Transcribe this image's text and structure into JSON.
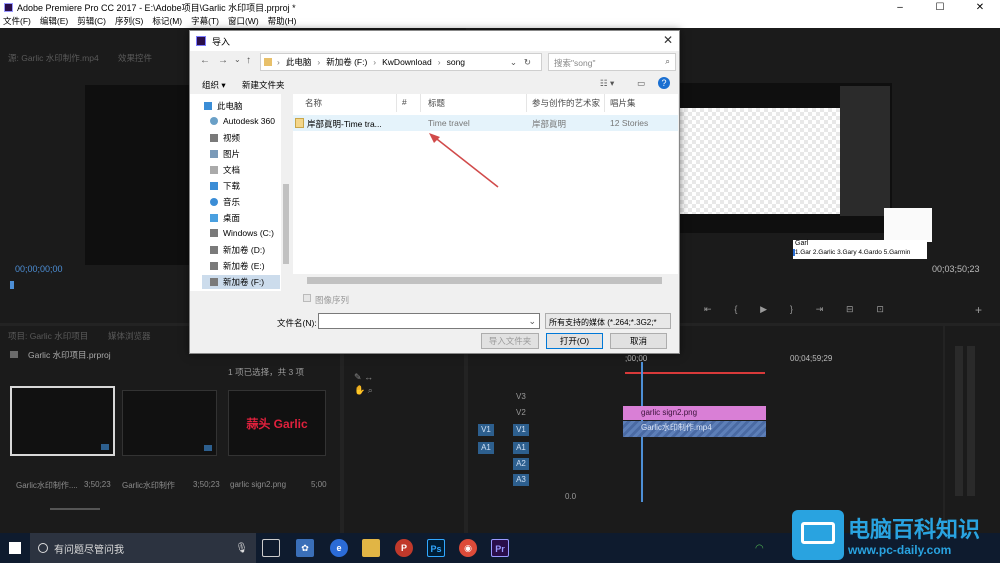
{
  "titlebar": {
    "title": "Adobe Premiere Pro CC 2017 - E:\\Adobe项目\\Garlic 水印项目.prproj *"
  },
  "menubar": {
    "items": [
      "文件(F)",
      "编辑(E)",
      "剪辑(C)",
      "序列(S)",
      "标记(M)",
      "字幕(T)",
      "窗口(W)",
      "帮助(H)"
    ]
  },
  "source_monitor": {
    "tab": "源: Garlic 水印制作.mp4",
    "tab2": "效果控件",
    "timecode_left": "00;00;00;00"
  },
  "program_monitor": {
    "timecode_right": "00;03;50;23",
    "autocomplete_input": "Garl",
    "autocomplete_suggestions": "1.Gar 2.Garlic 3.Gary 4.Gardo 5.Garmin"
  },
  "project_panel": {
    "tab": "项目: Garlic 水印项目",
    "tab2": "媒体浏览器",
    "project_file": "Garlic 水印项目.prproj",
    "selection_info": "1 项已选择，共 3 项",
    "items": [
      {
        "name": "Garlic水印制作....",
        "duration": "3;50;23"
      },
      {
        "name": "Garlic水印制作",
        "duration": "3;50;23"
      },
      {
        "name": "garlic sign2.png",
        "duration": "5;00"
      }
    ],
    "thumb3_text": "蒜头 Garlic"
  },
  "timeline": {
    "timecode_start": ";00;00",
    "timecode_mid": "00;04;59;29",
    "tracks_video": [
      "V3",
      "V2",
      "V1"
    ],
    "tracks_audio": [
      "A1",
      "A2",
      "A3"
    ],
    "source_v": "V1",
    "source_a": "A1",
    "clip_v2": "garlic sign2.png",
    "clip_v1": "Garlic水印制作.mp4",
    "master": "0.0"
  },
  "dialog": {
    "title": "导入",
    "path": [
      "此电脑",
      "新加卷 (F:)",
      "KwDownload",
      "song"
    ],
    "search_placeholder": "搜索\"song\"",
    "organize": "组织 ▾",
    "new_folder": "新建文件夹",
    "nav_items": [
      "此电脑",
      "Autodesk 360",
      "视频",
      "图片",
      "文档",
      "下载",
      "音乐",
      "桌面",
      "Windows (C:)",
      "新加卷 (D:)",
      "新加卷 (E:)",
      "新加卷 (F:)"
    ],
    "columns": [
      "名称",
      "#",
      "标题",
      "参与创作的艺术家",
      "唱片集"
    ],
    "file": {
      "name": "岸部眞明-Time tra...",
      "title": "Time travel",
      "artist": "岸部眞明",
      "album": "12 Stories"
    },
    "image_sequence": "图像序列",
    "filename_label": "文件名(N):",
    "filetype": "所有支持的媒体 (*.264;*.3G2;*",
    "import_folder": "导入文件夹",
    "open": "打开(O)",
    "cancel": "取消"
  },
  "taskbar": {
    "search_text": "有问题尽管问我"
  },
  "watermark": {
    "title": "电脑百科知识",
    "url": "www.pc-daily.com"
  }
}
